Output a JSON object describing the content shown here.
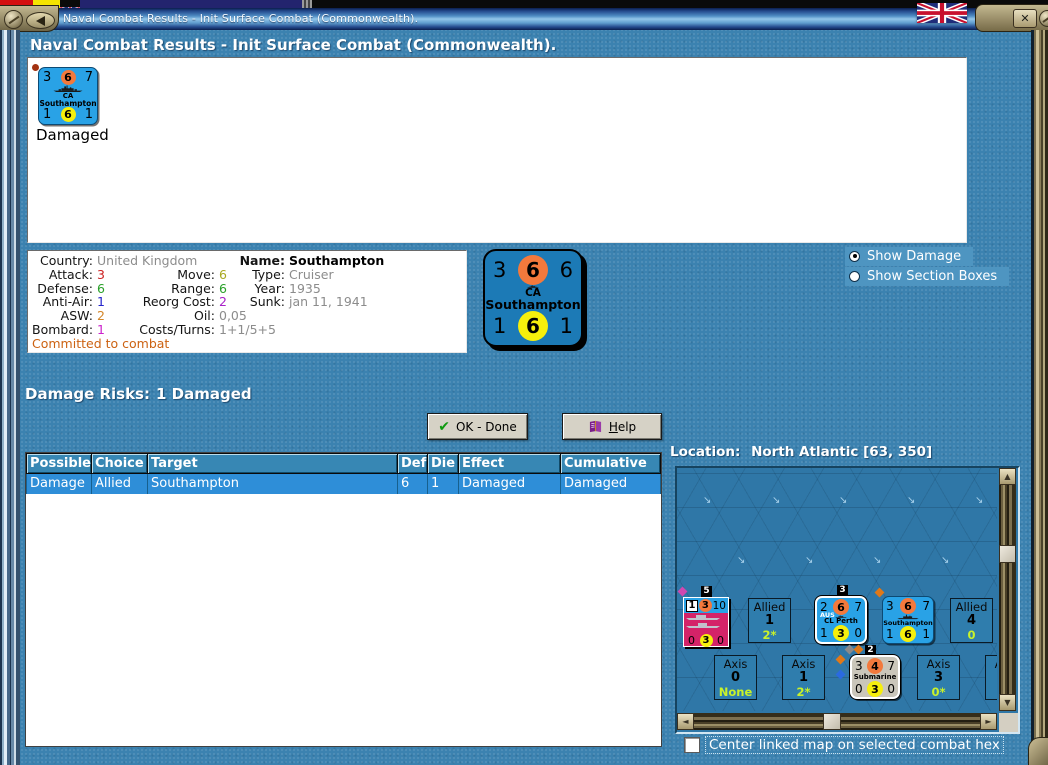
{
  "window": {
    "title": "Naval Combat Results - Init Surface Combat (Commonwealth).",
    "close_glyph": "✕",
    "flag_icon": "uk-flag"
  },
  "heading": "Naval Combat Results - Init Surface Combat (Commonwealth).",
  "unit_panel": {
    "counter": {
      "top": [
        "3",
        "6",
        "7"
      ],
      "type": "CA",
      "name": "Southampton",
      "bottom": [
        "1",
        "6",
        "1"
      ]
    },
    "status": "Damaged"
  },
  "info": {
    "country": {
      "label": "Country:",
      "value": "United Kingdom"
    },
    "attack": {
      "label": "Attack:",
      "value": "3"
    },
    "defense": {
      "label": "Defense:",
      "value": "6"
    },
    "antiair": {
      "label": "Anti-Air:",
      "value": "1"
    },
    "asw": {
      "label": "ASW:",
      "value": "2"
    },
    "bombard": {
      "label": "Bombard:",
      "value": "1"
    },
    "move": {
      "label": "Move:",
      "value": "6"
    },
    "range": {
      "label": "Range:",
      "value": "6"
    },
    "reorg": {
      "label": "Reorg Cost:",
      "value": "2"
    },
    "oil": {
      "label": "Oil:",
      "value": "0,05"
    },
    "costs": {
      "label": "Costs/Turns:",
      "value": "1+1/5+5"
    },
    "name": {
      "label": "Name:",
      "value": "Southampton"
    },
    "type": {
      "label": "Type:",
      "value": "Cruiser"
    },
    "year": {
      "label": "Year:",
      "value": "1935"
    },
    "sunk": {
      "label": "Sunk:",
      "value": "jan 11, 1941"
    },
    "committed": "Committed to combat"
  },
  "big_counter": {
    "top": [
      "3",
      "6",
      "6"
    ],
    "type": "CA",
    "name": "Southampton",
    "bottom": [
      "1",
      "6",
      "1"
    ]
  },
  "options": {
    "show_damage": {
      "label": "Show Damage",
      "selected": true
    },
    "show_section": {
      "label": "Show Section Boxes",
      "selected": false
    }
  },
  "damage_risks": {
    "label": "Damage Risks:",
    "value": "1 Damaged"
  },
  "buttons": {
    "ok": "OK - Done",
    "ok_icon": "✔",
    "help": "Help"
  },
  "table": {
    "columns": [
      "Possible",
      "Choice",
      "Target",
      "Def",
      "Die",
      "Effect",
      "Cumulative"
    ],
    "rows": [
      [
        "Damage",
        "Allied",
        "Southampton",
        "6",
        "1",
        "Damaged",
        "Damaged"
      ]
    ]
  },
  "location": {
    "label": "Location:",
    "value": "North Atlantic [63, 350]"
  },
  "map": {
    "sea_mark": "↘",
    "scroll": {
      "up": "▲",
      "down": "▼",
      "left": "◄",
      "right": "►"
    },
    "counters": {
      "task_force": {
        "t1": "1",
        "t2": "3",
        "t3": "10",
        "bottom": [
          "0",
          "3",
          "0"
        ],
        "badge": "5"
      },
      "perth": {
        "top": [
          "2",
          "6",
          "7"
        ],
        "nat": "AUS",
        "name": "CL Perth",
        "bottom": [
          "1",
          "3",
          "0"
        ],
        "badge": "3"
      },
      "southampton": {
        "top": [
          "3",
          "6",
          "7"
        ],
        "name": "Southampton",
        "bottom": [
          "1",
          "6",
          "1"
        ]
      },
      "submarine": {
        "top": [
          "3",
          "4",
          "7"
        ],
        "name": "Submarine",
        "bottom": [
          "0",
          "3",
          "0"
        ],
        "badge": "2"
      }
    },
    "boxes": [
      {
        "side": "Allied",
        "num": "1",
        "sub": "2*"
      },
      {
        "side": "Allied",
        "num": "4",
        "sub": "0"
      },
      {
        "side": "Axis",
        "num": "0",
        "sub": "None"
      },
      {
        "side": "Axis",
        "num": "1",
        "sub": "2*"
      },
      {
        "side": "Axis",
        "num": "3",
        "sub": "0*"
      },
      {
        "side": "Axis",
        "num": "",
        "sub": ""
      }
    ]
  },
  "checkbox": {
    "label": "Center linked map on selected combat hex",
    "checked": false
  },
  "colors": {
    "background": "#3b82b0",
    "counter_blue": "#29a2e6",
    "big_counter_blue": "#1c7ab6",
    "counter_pink": "#d42368",
    "counter_gray": "#cac6ba",
    "orange_circle": "#f3793c",
    "yellow_circle": "#f6ef0c",
    "selected_row": "#2e8ed8",
    "table_header": "#3787b4",
    "axis_sub_green": "#c9f22a",
    "committed_orange": "#cc6212"
  }
}
